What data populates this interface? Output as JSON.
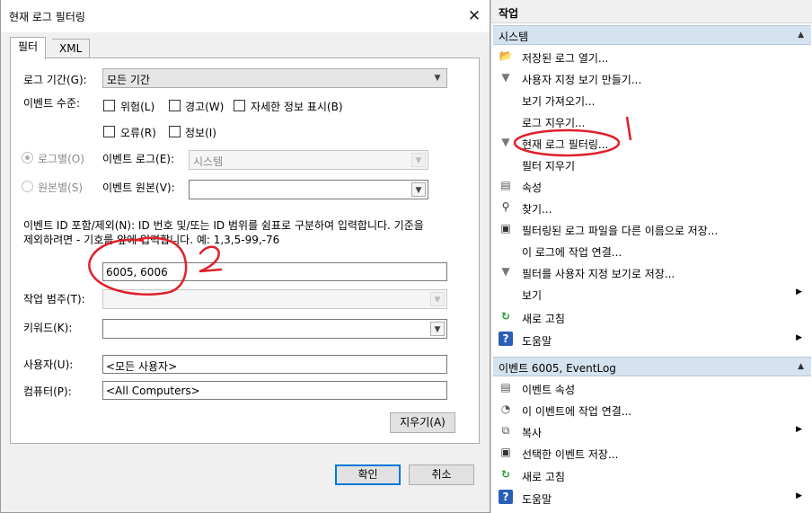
{
  "dialog": {
    "title": "현재 로그 필터링",
    "tabs": [
      "필터",
      "XML"
    ],
    "log_period_label": "로그 기간(G):",
    "log_period_value": "모든 기간",
    "event_level_label": "이벤트 수준:",
    "levels": {
      "critical": "위험(L)",
      "warning": "경고(W)",
      "verbose": "자세한 정보 표시(B)",
      "error": "오류(R)",
      "info": "정보(I)"
    },
    "by_log_label": "로그별(O)",
    "by_source_label": "원본별(S)",
    "event_logs_label": "이벤트 로그(E):",
    "event_logs_value": "시스템",
    "event_sources_label": "이벤트 원본(V):",
    "event_id_description": "이벤트 ID 포함/제외(N): ID 번호 및/또는 ID 범위를 쉼표로 구분하여 입력합니다. 기준을 제외하려면 - 기호를 앞에 입력합니다. 예: 1,3,5-99,-76",
    "event_id_desc_line1": "이벤트 ID 포함/제외(N): ID 번호 및/또는 ID 범위를 쉼표로 구분하여 입력합니다. 기준을",
    "event_id_desc_line2": "제외하려면 - 기호를 앞에 입력합니다. 예: 1,3,5-99,-76",
    "event_id_value": "6005, 6006",
    "task_category_label": "작업 범주(T):",
    "keywords_label": "키워드(K):",
    "user_label": "사용자(U):",
    "user_value": "<모든 사용자>",
    "computer_label": "컴퓨터(P):",
    "computer_value": "<All Computers>",
    "clear_button": "지우기(A)",
    "ok_button": "확인",
    "cancel_button": "취소"
  },
  "actions": {
    "header": "작업",
    "section1_title": "시스템",
    "section1_items": [
      "저장된 로그 열기...",
      "사용자 지정 보기 만들기...",
      "보기 가져오기...",
      "로그 지우기...",
      "현재 로그 필터링...",
      "필터 지우기",
      "속성",
      "찾기...",
      "필터링된 로그 파일을 다른 이름으로 저장...",
      "이 로그에 작업 연결...",
      "필터를 사용자 지정 보기로 저장...",
      "보기",
      "새로 고침",
      "도움말"
    ],
    "section2_title": "이벤트 6005, EventLog",
    "section2_items": [
      "이벤트 속성",
      "이 이벤트에 작업 연결...",
      "복사",
      "선택한 이벤트 저장...",
      "새로 고침",
      "도움말"
    ]
  },
  "annotations": {
    "mark1": "1",
    "mark2": "2"
  },
  "colors": {
    "annotation": "#e0202a",
    "section_header": "#d5e2ef",
    "primary_border": "#0078d7"
  }
}
